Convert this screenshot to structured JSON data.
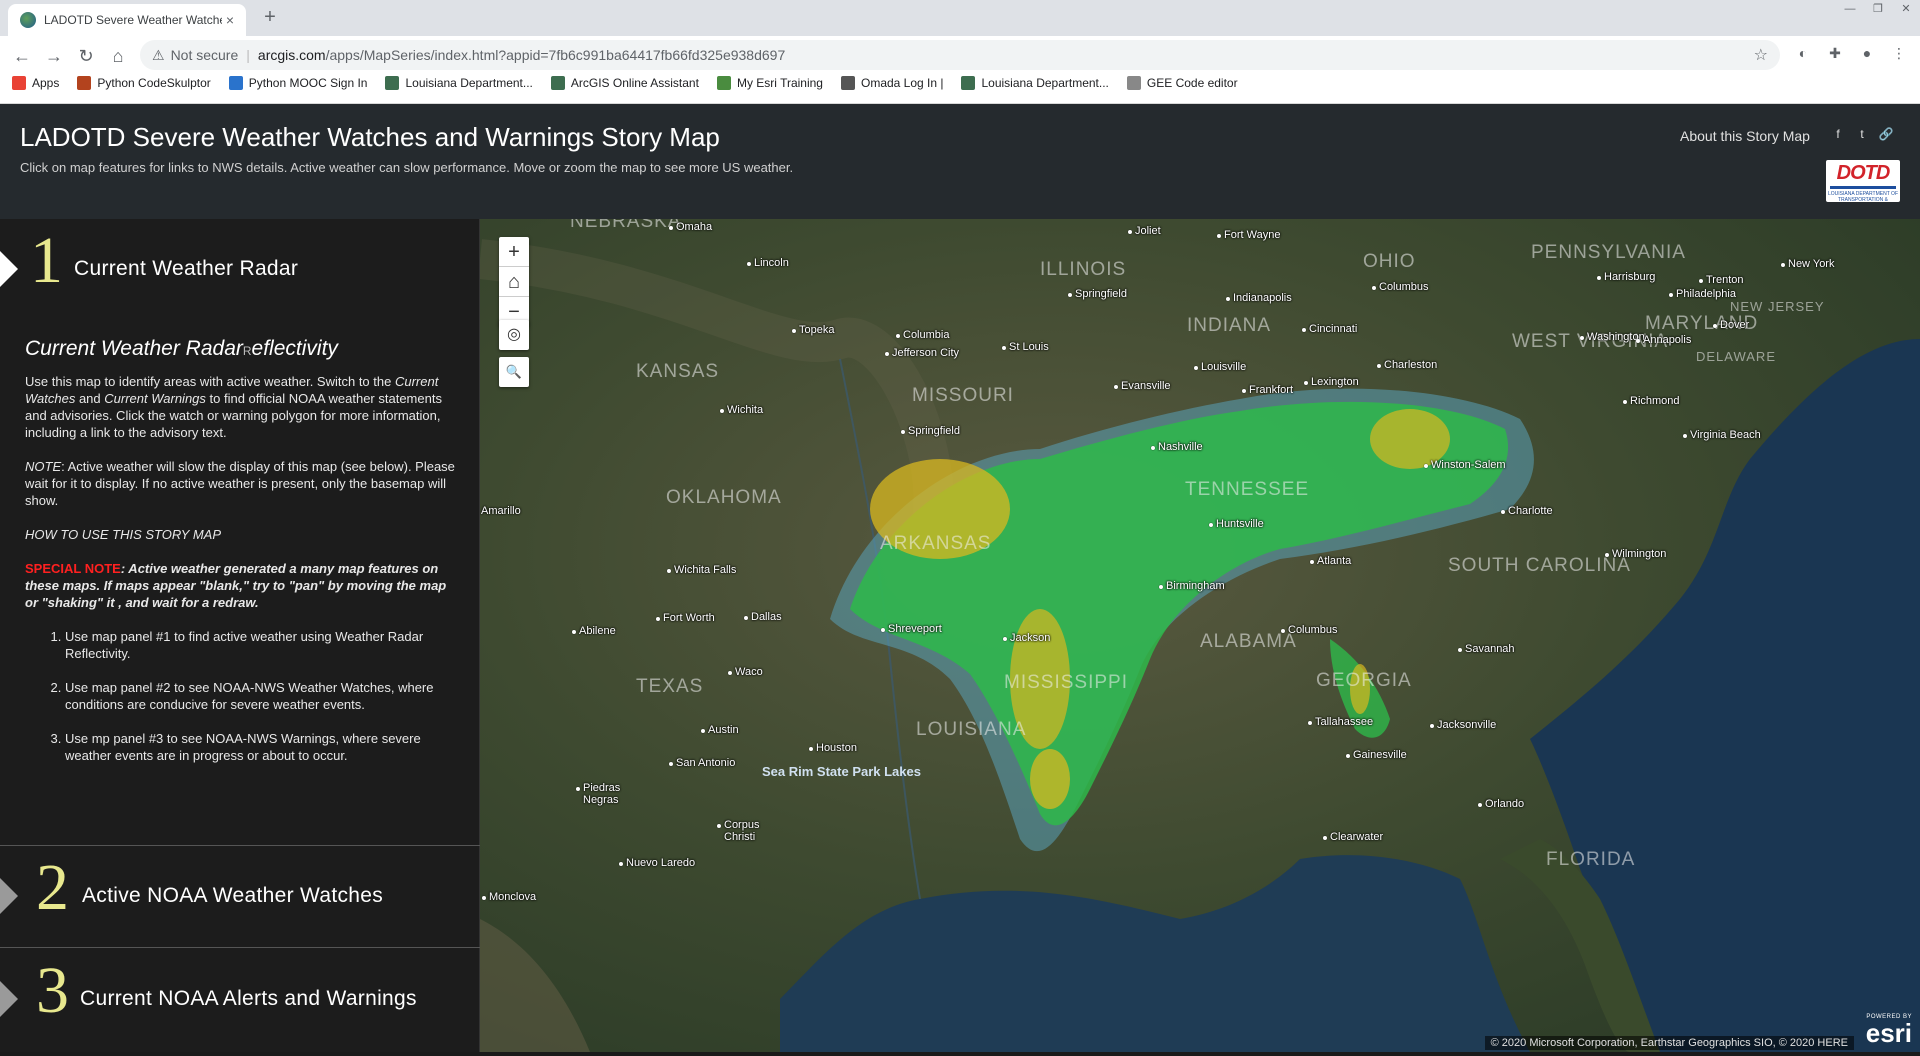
{
  "browser": {
    "tab_title": "LADOTD Severe Weather Watches and Warnings Story Map",
    "tab_close": "×",
    "new_tab": "+",
    "window_controls": [
      "—",
      "❐",
      "✕"
    ],
    "not_secure": "Not secure",
    "url_domain": "arcgis.com",
    "url_path": "/apps/MapSeries/index.html?appid=7fb6c991ba64417fb66fd325e938d697",
    "bookmarks": [
      {
        "label": "Apps",
        "icon": "apps-grid-icon",
        "color": "#e94235"
      },
      {
        "label": "Python CodeSkulptor",
        "icon": "pickaxe-icon",
        "color": "#b3431e"
      },
      {
        "label": "Python MOOC Sign In",
        "icon": "coursera-icon",
        "color": "#2a73cc"
      },
      {
        "label": "Louisiana Department...",
        "icon": "globe-icon",
        "color": "#3d6d4f"
      },
      {
        "label": "ArcGIS Online Assistant",
        "icon": "globe-icon",
        "color": "#3d6d4f"
      },
      {
        "label": "My Esri Training",
        "icon": "esri-training-icon",
        "color": "#4a8c3f"
      },
      {
        "label": "Omada Log In |",
        "icon": "omada-icon",
        "color": "#555555"
      },
      {
        "label": "Louisiana Department...",
        "icon": "globe-icon",
        "color": "#3d6d4f"
      },
      {
        "label": "GEE Code editor",
        "icon": "gear-icon",
        "color": "#888888"
      }
    ]
  },
  "header": {
    "title": "LADOTD Severe Weather Watches and Warnings Story Map",
    "subtitle": "Click on map features for links to NWS details. Active weather can slow performance. Move or zoom the map to see more US weather.",
    "about": "About this Story Map",
    "logo_text": "DOTD",
    "logo_caption": "LOUISIANA DEPARTMENT OF TRANSPORTATION & DEVELOPMENT"
  },
  "entries": [
    {
      "number": "1",
      "title": "Current Weather Radar"
    },
    {
      "number": "2",
      "title": "Active NOAA Weather Watches"
    },
    {
      "number": "3",
      "title": "Current NOAA Alerts and Warnings"
    }
  ],
  "content": {
    "heading": "Current Weather Radar",
    "heading_suffix_small": "R",
    "heading_suffix": "eflectivity",
    "p1_a": "Use this map to identify areas with active weather. Switch to the ",
    "p1_current_watches": "Current Watches",
    "p1_b": " and ",
    "p1_current_warnings": "Current Warnings",
    "p1_c": " to find official NOAA weather statements and advisories. Click the watch or warning polygon for more information, including a link to the advisory text.",
    "note_label": "NOTE",
    "note_text": ": Active weather will slow the display of this map (see below). Please wait for it to display. If no active weather is present, only the basemap will show.",
    "how_to": "HOW TO USE THIS STORY MAP",
    "special_label": "SPECIAL NOTE",
    "special_text": ": Active weather generated a many map features on these maps. If maps appear \"blank,\" try to \"pan\" by moving the map or \"shaking\" it , and wait for a redraw.",
    "steps": [
      "Use map panel #1 to find active weather using Weather Radar Reflectivity.",
      "Use map panel #2 to see NOAA-NWS Weather Watches, where conditions are conducive for severe weather events.",
      "Use mp panel #3 to see NOAA-NWS Warnings, where severe weather events are in progress or about to occur."
    ]
  },
  "map": {
    "zoom_in": "+",
    "home": "⌂",
    "zoom_out": "−",
    "locate": "◎",
    "search": "🔍",
    "attribution": "© 2020 Microsoft Corporation, Earthstar Geographics SIO, © 2020 HERE",
    "esri_powered": "POWERED BY",
    "esri_logo": "esri",
    "states": [
      "NEBRASKA",
      "ILLINOIS",
      "OHIO",
      "PENNSYLVANIA",
      "INDIANA",
      "KANSAS",
      "MISSOURI",
      "WEST VIRGINIA",
      "MARYLAND",
      "DELAWARE",
      "NEW JERSEY",
      "OKLAHOMA",
      "TENNESSEE",
      "ARKANSAS",
      "SOUTH CAROLINA",
      "TEXAS",
      "MISSISSIPPI",
      "ALABAMA",
      "GEORGIA",
      "LOUISIANA",
      "FLORIDA"
    ],
    "cities": [
      "Omaha",
      "Joliet",
      "Fort Wayne",
      "Lincoln",
      "Springfield",
      "Indianapolis",
      "Columbus",
      "Harrisburg",
      "Trenton",
      "New York",
      "Philadelphia",
      "Topeka",
      "Columbia",
      "Jefferson City",
      "St Louis",
      "Cincinnati",
      "Washington",
      "Annapolis",
      "Dover",
      "Louisville",
      "Charleston",
      "Evansville",
      "Frankfort",
      "Lexington",
      "Wichita",
      "Springfield",
      "Richmond",
      "Virginia Beach",
      "Nashville",
      "Winston-Salem",
      "Charlotte",
      "Wichita Falls",
      "Huntsville",
      "Atlanta",
      "Wilmington",
      "Fort Worth",
      "Dallas",
      "Shreveport",
      "Birmingham",
      "Abilene",
      "Jackson",
      "Columbus",
      "Savannah",
      "Waco",
      "Austin",
      "Houston",
      "Tallahassee",
      "Jacksonville",
      "San Antonio",
      "Gainesville",
      "Piedras Negras",
      "Orlando",
      "Corpus Christi",
      "Clearwater",
      "Nuevo Laredo",
      "Monclova",
      "Amarillo"
    ],
    "park": "Sea Rim State Park Lakes"
  }
}
